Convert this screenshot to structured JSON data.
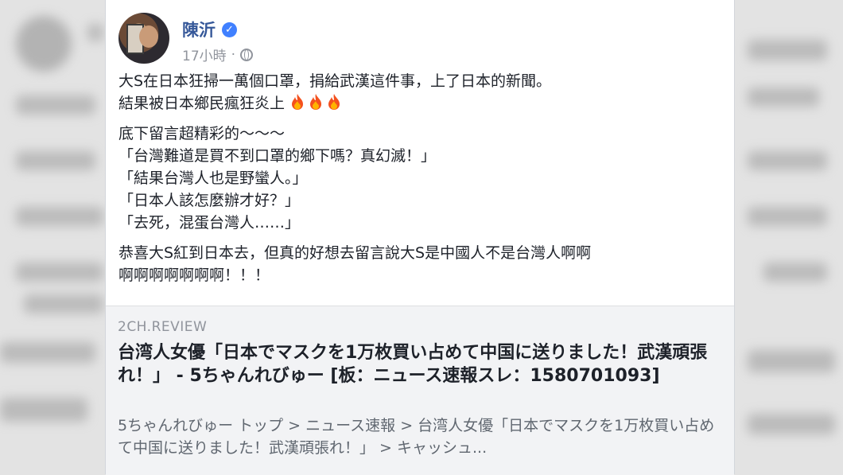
{
  "post": {
    "author": "陳沂",
    "timestamp": "17小時",
    "separator": "·",
    "body": {
      "para1": [
        "大S在日本狂掃一萬個口罩，捐給武漢這件事，上了日本的新聞。",
        "結果被日本鄉民瘋狂炎上"
      ],
      "emoji": [
        "fire-icon",
        "fire-icon",
        "fire-icon"
      ],
      "para2": [
        "底下留言超精彩的～～～",
        "「台灣難道是買不到口罩的鄉下嗎？真幻滅！」",
        "「結果台灣人也是野蠻人。」",
        "「日本人該怎麼辦才好？」",
        "「去死，混蛋台灣人……」"
      ],
      "para3": [
        "恭喜大S紅到日本去，但真的好想去留言說大S是中國人不是台灣人啊啊",
        "啊啊啊啊啊啊啊！！！"
      ]
    }
  },
  "link": {
    "domain": "2CH.REVIEW",
    "title": "台湾人女優「日本でマスクを1万枚買い占めて中国に送りました！武漢頑張れ！」 - 5ちゃんれびゅー [板：ニュース速報スレ：1580701093]",
    "description": "5ちゃんれびゅー トップ > ニュース速報 > 台湾人女優「日本でマスクを1万枚買い占めて中国に送りました！武漢頑張れ！」 > キャッシュ..."
  },
  "colors": {
    "author": "#365899",
    "verified": "#4080ff",
    "meta": "#90949c",
    "text": "#1d2129",
    "preview_bg": "#f2f3f5"
  }
}
